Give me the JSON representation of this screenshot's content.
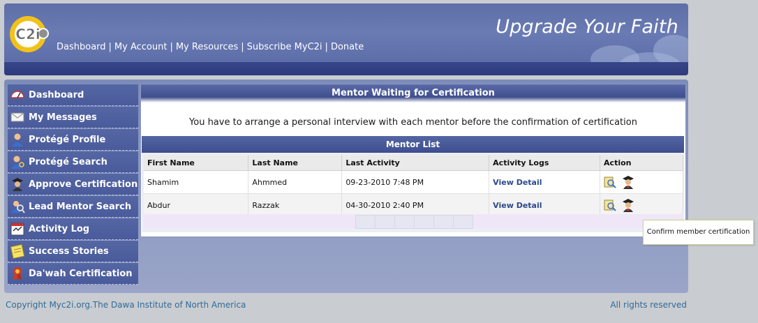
{
  "header": {
    "logo_text": "C2i",
    "tagline": "Upgrade Your Faith",
    "nav": [
      {
        "label": "Dashboard"
      },
      {
        "label": "My Account"
      },
      {
        "label": "My Resources"
      },
      {
        "label": "Subscribe MyC2i"
      },
      {
        "label": "Donate"
      }
    ],
    "separator": "|"
  },
  "sidebar": {
    "items": [
      {
        "label": "Dashboard",
        "icon": "speedometer-icon"
      },
      {
        "label": "My Messages",
        "icon": "envelope-icon"
      },
      {
        "label": "Protégé Profile",
        "icon": "user-profile-icon"
      },
      {
        "label": "Protégé Search",
        "icon": "user-search-icon"
      },
      {
        "label": "Approve Certification",
        "icon": "graduate-icon"
      },
      {
        "label": "Lead Mentor Search",
        "icon": "magnifier-user-icon"
      },
      {
        "label": "Activity Log",
        "icon": "calendar-log-icon"
      },
      {
        "label": "Success Stories",
        "icon": "notepad-icon"
      },
      {
        "label": "Da'wah Certification",
        "icon": "award-ribbon-icon"
      }
    ]
  },
  "content": {
    "title": "Mentor Waiting for Certification",
    "instruction": "You have to arrange a personal interview with each mentor before the confirmation of certification",
    "list_title": "Mentor List",
    "columns": [
      "First Name",
      "Last Name",
      "Last Activity",
      "Activity Logs",
      "Action"
    ],
    "rows": [
      {
        "first": "Shamim",
        "last": "Ahmmed",
        "activity": "09-23-2010 7:48 PM",
        "logs": "View Detail"
      },
      {
        "first": "Abdur",
        "last": "Razzak",
        "activity": "04-30-2010 2:40 PM",
        "logs": "View Detail"
      }
    ]
  },
  "tooltip": "Confirm member certification",
  "footer": {
    "copyright": "Copyright Myc2i.org.The Dawa Institute of North America",
    "rights": "All rights reserved"
  },
  "colors": {
    "header_bg": "#6a7bb4",
    "sidebar_bg": "#4f60a0",
    "link": "#2b4a8a",
    "footer_text": "#2f6b9a"
  }
}
